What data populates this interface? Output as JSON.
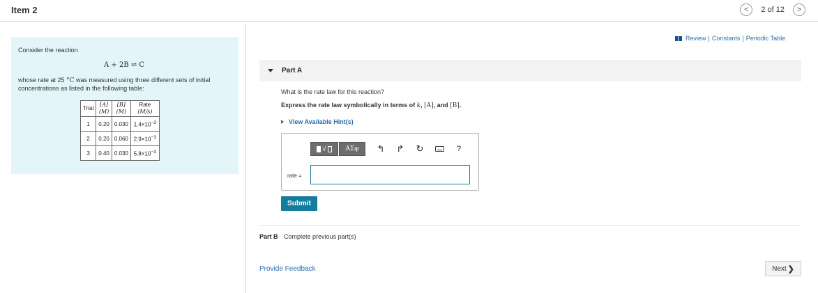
{
  "header": {
    "title": "Item 2",
    "pager_text": "2 of 12",
    "prev_icon": "<",
    "next_icon": ">"
  },
  "problem": {
    "intro": "Consider the reaction",
    "equation": "A + 2B ⇌ C",
    "desc_prefix": "whose rate at 25 ",
    "desc_temp": "°C",
    "desc_suffix": " was measured using three different sets of initial concentrations as listed in the following table:",
    "table": {
      "headers": {
        "trial": "Trial",
        "a_top": "[A]",
        "a_unit": "(M)",
        "b_top": "[B]",
        "b_unit": "(M)",
        "rate_top": "Rate",
        "rate_unit": "(M/s)"
      },
      "rows": [
        {
          "trial": "1",
          "a": "0.20",
          "b": "0.030",
          "rate_base": "1.4×10",
          "rate_exp": "−3"
        },
        {
          "trial": "2",
          "a": "0.20",
          "b": "0.060",
          "rate_base": "2.9×10",
          "rate_exp": "−3"
        },
        {
          "trial": "3",
          "a": "0.40",
          "b": "0.030",
          "rate_base": "5.8×10",
          "rate_exp": "−3"
        }
      ]
    }
  },
  "links": {
    "review": "Review",
    "sep": "|",
    "constants": "Constants",
    "periodic": "Periodic Table"
  },
  "partA": {
    "label": "Part A",
    "question": "What is the rate law for this reaction?",
    "instruction_prefix": "Express the rate law symbolically in terms of ",
    "instruction_k": "k",
    "instruction_a": "[A]",
    "instruction_and": ", and ",
    "instruction_b": "[B]",
    "instruction_end": ".",
    "hint": "View Available Hint(s)",
    "toolbar": {
      "greek": "ΑΣφ",
      "undo_glyph": "↰",
      "redo_glyph": "↱",
      "reset_glyph": "↻",
      "help_glyph": "?"
    },
    "rate_label": "rate =",
    "input_value": "",
    "submit": "Submit"
  },
  "partB": {
    "label": "Part B",
    "text": "Complete previous part(s)"
  },
  "footer": {
    "feedback": "Provide Feedback",
    "next": "Next",
    "next_glyph": "❯"
  },
  "colors": {
    "accent": "#147d9f",
    "link": "#2a6db0",
    "panel_bg": "#e3f5f8"
  }
}
